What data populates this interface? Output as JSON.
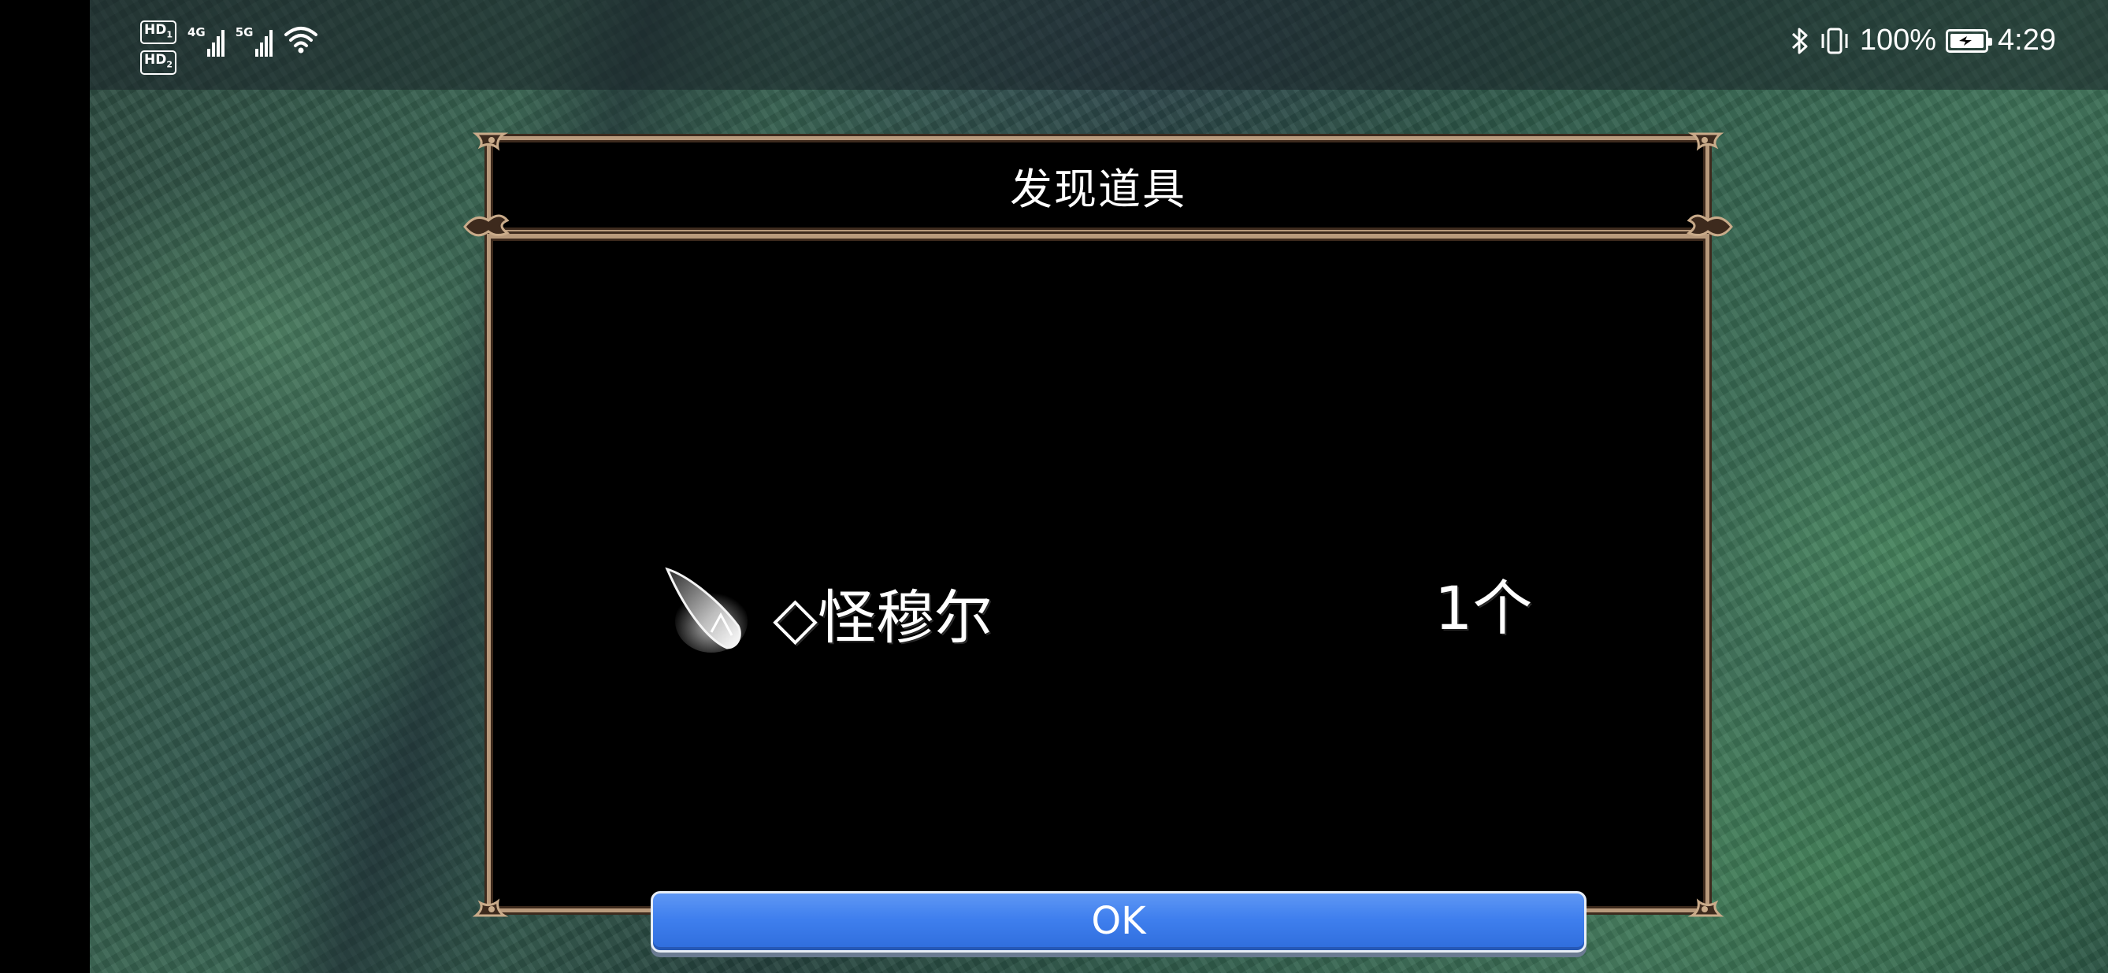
{
  "status_bar": {
    "sim1": "HD",
    "sim1_index": "1",
    "sim2": "HD",
    "sim2_index": "2",
    "net1": "4G",
    "net2": "5G",
    "battery_percent": "100%",
    "time": "4:29",
    "icons": [
      "bluetooth-icon",
      "vibrate-icon",
      "battery-charging-icon",
      "wifi-icon",
      "signal-icon"
    ]
  },
  "dialog": {
    "title": "发现道具",
    "item": {
      "icon": "crystal-shard-icon",
      "name": "◇怪穆尔",
      "count": "1个"
    },
    "ok_label": "OK",
    "colors": {
      "frame": "#b89a7c",
      "button": "#3f7fee",
      "panel": "#000000"
    }
  }
}
